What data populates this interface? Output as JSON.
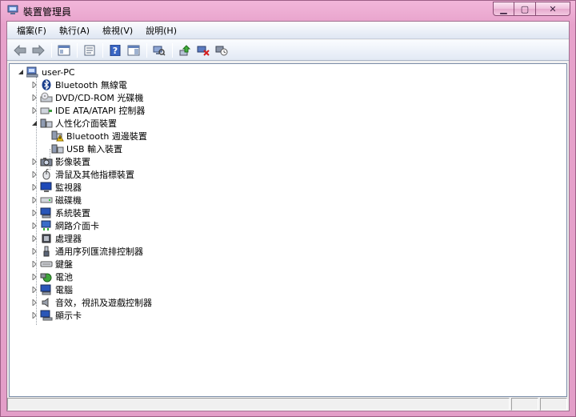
{
  "window": {
    "title": "裝置管理員",
    "buttons": {
      "minimize": "▁",
      "maximize": "▢",
      "close": "✕"
    }
  },
  "menubar": {
    "items": [
      "檔案(F)",
      "執行(A)",
      "檢視(V)",
      "說明(H)"
    ]
  },
  "toolbar": {
    "buttons": [
      "back-icon",
      "forward-icon",
      "show-hide-tree-icon",
      "properties-icon",
      "help-icon",
      "action-pane-icon",
      "scan-hardware-icon",
      "update-driver-icon",
      "uninstall-icon",
      "disable-icon"
    ]
  },
  "tree": {
    "root": "user-PC",
    "categories": [
      {
        "label": "Bluetooth 無線電",
        "expanded": false,
        "icon": "bluetooth-icon"
      },
      {
        "label": "DVD/CD-ROM 光碟機",
        "expanded": false,
        "icon": "optical-drive-icon"
      },
      {
        "label": "IDE ATA/ATAPI 控制器",
        "expanded": false,
        "icon": "ide-controller-icon"
      },
      {
        "label": "人性化介面裝置",
        "expanded": true,
        "icon": "hid-icon",
        "children": [
          {
            "label": "Bluetooth 週邊裝置",
            "icon": "warning-device-icon"
          },
          {
            "label": "USB 輸入裝置",
            "icon": "hid-device-icon"
          }
        ]
      },
      {
        "label": "影像裝置",
        "expanded": false,
        "icon": "camera-icon"
      },
      {
        "label": "滑鼠及其他指標裝置",
        "expanded": false,
        "icon": "mouse-icon"
      },
      {
        "label": "監視器",
        "expanded": false,
        "icon": "monitor-icon"
      },
      {
        "label": "磁碟機",
        "expanded": false,
        "icon": "disk-drive-icon"
      },
      {
        "label": "系統裝置",
        "expanded": false,
        "icon": "system-device-icon"
      },
      {
        "label": "網路介面卡",
        "expanded": false,
        "icon": "network-adapter-icon"
      },
      {
        "label": "處理器",
        "expanded": false,
        "icon": "processor-icon"
      },
      {
        "label": "通用序列匯流排控制器",
        "expanded": false,
        "icon": "usb-icon"
      },
      {
        "label": "鍵盤",
        "expanded": false,
        "icon": "keyboard-icon"
      },
      {
        "label": "電池",
        "expanded": false,
        "icon": "battery-icon"
      },
      {
        "label": "電腦",
        "expanded": false,
        "icon": "computer-icon"
      },
      {
        "label": "音效，視訊及遊戲控制器",
        "expanded": false,
        "icon": "speaker-icon"
      },
      {
        "label": "顯示卡",
        "expanded": false,
        "icon": "display-adapter-icon"
      }
    ]
  }
}
